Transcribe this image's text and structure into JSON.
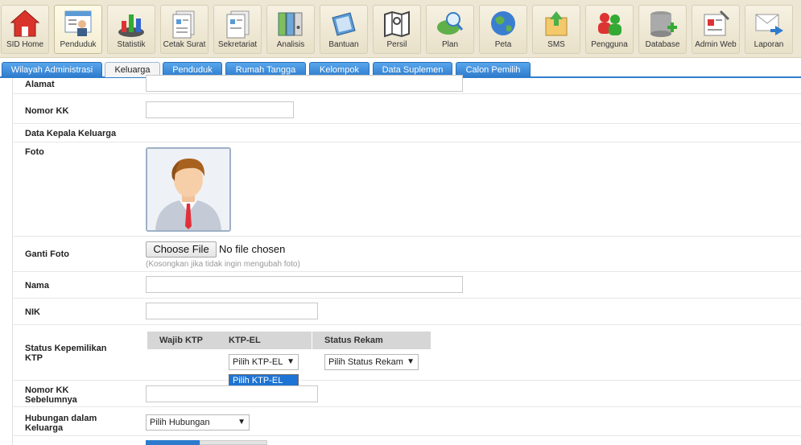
{
  "toolbar": {
    "items": [
      {
        "label": "SID Home",
        "icon": "home-icon"
      },
      {
        "label": "Penduduk",
        "icon": "population-icon"
      },
      {
        "label": "Statistik",
        "icon": "statistics-icon"
      },
      {
        "label": "Cetak Surat",
        "icon": "print-letter-icon"
      },
      {
        "label": "Sekretariat",
        "icon": "secretariat-icon"
      },
      {
        "label": "Analisis",
        "icon": "analysis-icon"
      },
      {
        "label": "Bantuan",
        "icon": "aid-icon"
      },
      {
        "label": "Persil",
        "icon": "land-map-icon"
      },
      {
        "label": "Plan",
        "icon": "plan-icon"
      },
      {
        "label": "Peta",
        "icon": "globe-icon"
      },
      {
        "label": "SMS",
        "icon": "sms-icon"
      },
      {
        "label": "Pengguna",
        "icon": "users-icon"
      },
      {
        "label": "Database",
        "icon": "database-icon"
      },
      {
        "label": "Admin Web",
        "icon": "admin-web-icon"
      },
      {
        "label": "Laporan",
        "icon": "report-icon"
      }
    ]
  },
  "tabs": [
    {
      "label": "Wilayah Administrasi"
    },
    {
      "label": "Keluarga"
    },
    {
      "label": "Penduduk"
    },
    {
      "label": "Rumah Tangga"
    },
    {
      "label": "Kelompok"
    },
    {
      "label": "Data Suplemen"
    },
    {
      "label": "Calon Pemilih"
    }
  ],
  "form": {
    "alamat_label": "Alamat",
    "nomor_kk_label": "Nomor KK",
    "section_kepala": "Data Kepala Keluarga",
    "foto_label": "Foto",
    "ganti_foto_label": "Ganti Foto",
    "choose_file_label": "Choose File",
    "no_file_text": "No file chosen",
    "ganti_foto_hint": "(Kosongkan jika tidak ingin mengubah foto)",
    "nama_label": "Nama",
    "nik_label": "NIK",
    "status_ktp_label": "Status Kepemilikan KTP",
    "ktp_headers": [
      "Wajib KTP",
      "KTP-EL",
      "Status Rekam"
    ],
    "ktp_el_select": "Pilih KTP-EL",
    "ktp_el_option": "Pilih KTP-EL",
    "status_rekam_select": "Pilih Status Rekam",
    "nomor_kk_sebelumnya_label": "Nomor KK Sebelumnya",
    "hubungan_label": "Hubungan dalam Keluarga",
    "hubungan_select": "Pilih Hubungan"
  },
  "colors": {
    "tab_blue": "#2d7bcc",
    "selected_option": "#1e74d4"
  }
}
